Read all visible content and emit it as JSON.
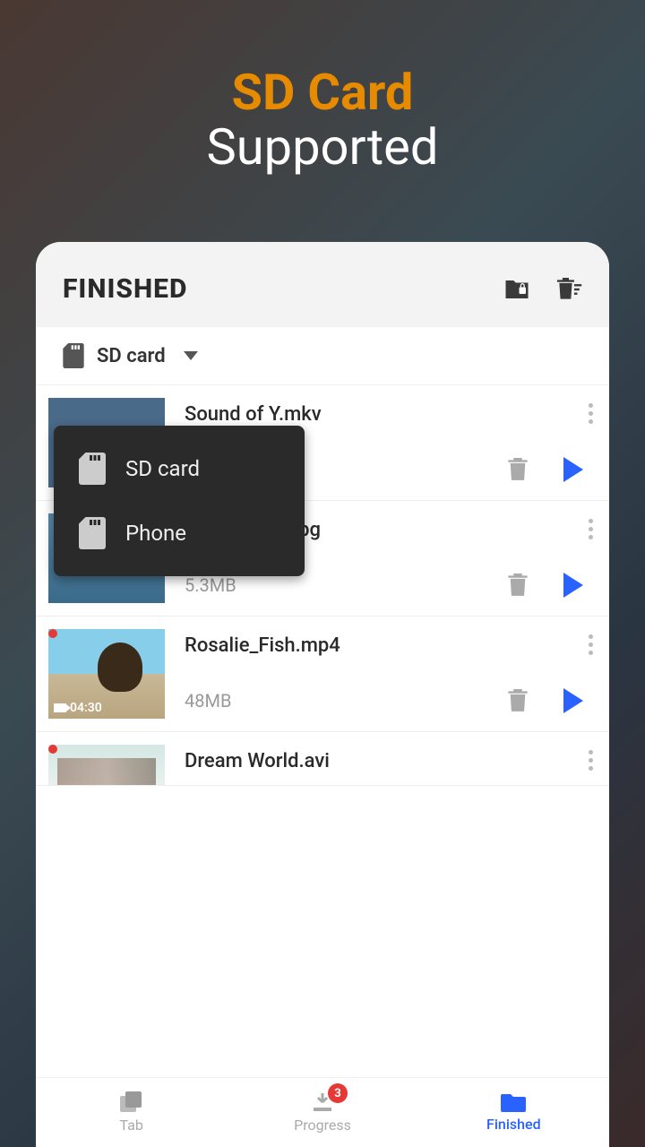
{
  "promo": {
    "line1": "SD Card",
    "line2": "Supported"
  },
  "header": {
    "title": "FINISHED"
  },
  "storage": {
    "selected": "SD card",
    "options": [
      "SD card",
      "Phone"
    ]
  },
  "files": [
    {
      "name": "Sound of Y.mkv",
      "size": ""
    },
    {
      "name": "Saint Island.jpg",
      "size": "5.3MB"
    },
    {
      "name": "Rosalie_Fish.mp4",
      "size": "48MB",
      "duration": "04:30"
    },
    {
      "name": "Dream World.avi",
      "size": ""
    }
  ],
  "nav": {
    "tab": "Tab",
    "progress": "Progress",
    "progressBadge": "3",
    "finished": "Finished"
  }
}
